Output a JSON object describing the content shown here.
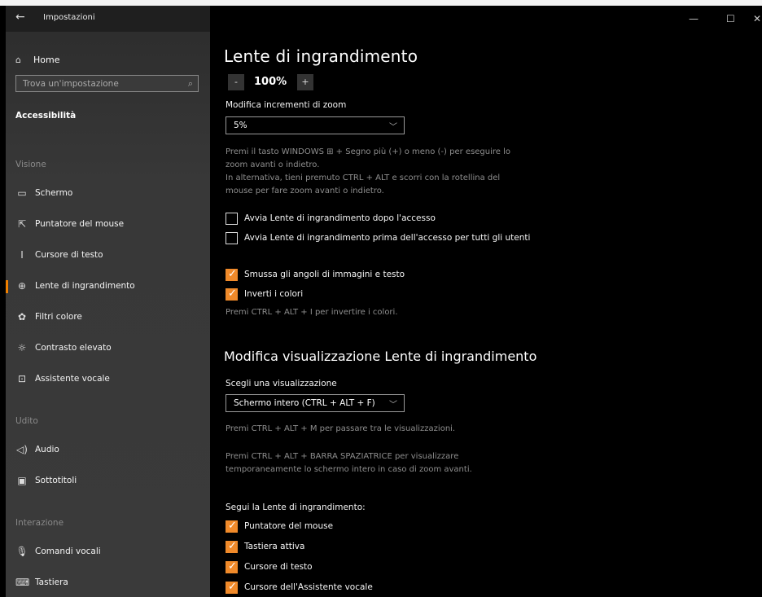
{
  "window": {
    "title": "Impostazioni",
    "back_icon": "←",
    "minimize_icon": "—",
    "maximize_icon": "☐",
    "close_icon": "✕"
  },
  "sidebar": {
    "home": "Home",
    "home_icon": "⌂",
    "search_placeholder": "Trova un'impostazione",
    "search_icon": "⌕",
    "category": "Accessibilità",
    "groups": {
      "visione": "Visione",
      "udito": "Udito",
      "interazione": "Interazione"
    },
    "items": [
      {
        "label": "Schermo",
        "icon": "▭"
      },
      {
        "label": "Puntatore del mouse",
        "icon": "⇱"
      },
      {
        "label": "Cursore di testo",
        "icon": "I"
      },
      {
        "label": "Lente di ingrandimento",
        "icon": "⊕"
      },
      {
        "label": "Filtri colore",
        "icon": "✿"
      },
      {
        "label": "Contrasto elevato",
        "icon": "☼"
      },
      {
        "label": "Assistente vocale",
        "icon": "⊡"
      },
      {
        "label": "Audio",
        "icon": "◁)"
      },
      {
        "label": "Sottotitoli",
        "icon": "▣"
      },
      {
        "label": "Comandi vocali",
        "icon": "🎙"
      },
      {
        "label": "Tastiera",
        "icon": "⌨"
      }
    ]
  },
  "main": {
    "title": "Lente di ingrandimento",
    "zoom": {
      "minus": "-",
      "value": "100%",
      "plus": "+"
    },
    "zoom_increment_label": "Modifica incrementi di zoom",
    "zoom_increment_value": "5%",
    "help1_line1": "Premi il tasto WINDOWS ⊞ + Segno più (+) o meno (-) per eseguire lo",
    "help1_line2": "zoom avanti o indietro.",
    "help1_line3": "In alternativa, tieni premuto CTRL + ALT e scorri con la rotellina del",
    "help1_line4": "mouse per fare zoom avanti o indietro.",
    "checkboxes": [
      {
        "label": "Avvia Lente di ingrandimento dopo l'accesso",
        "checked": false
      },
      {
        "label": "Avvia Lente di ingrandimento prima dell'accesso per tutti gli utenti",
        "checked": false
      },
      {
        "label": "Smussa gli angoli di immagini e testo",
        "checked": true
      },
      {
        "label": "Inverti i colori",
        "checked": true
      }
    ],
    "invert_help": "Premi CTRL + ALT + I per invertire i colori.",
    "view_section_title": "Modifica visualizzazione Lente di ingrandimento",
    "view_label": "Scegli una visualizzazione",
    "view_value": "Schermo intero (CTRL + ALT + F)",
    "view_help": "Premi CTRL + ALT + M per passare tra le visualizzazioni.",
    "space_help_line1": "Premi CTRL + ALT + BARRA SPAZIATRICE per visualizzare",
    "space_help_line2": "temporaneamente lo schermo intero in caso di zoom avanti.",
    "follow_label": "Segui la Lente di ingrandimento:",
    "follow": [
      {
        "label": "Puntatore del mouse",
        "checked": true
      },
      {
        "label": "Tastiera attiva",
        "checked": true
      },
      {
        "label": "Cursore di testo",
        "checked": true
      },
      {
        "label": "Cursore dell'Assistente vocale",
        "checked": true
      }
    ],
    "chevron_icon": "﹀",
    "check_icon": "✓"
  },
  "colors": {
    "accent": "#f08a2a",
    "background": "#000000",
    "sidebar": "#383838"
  }
}
